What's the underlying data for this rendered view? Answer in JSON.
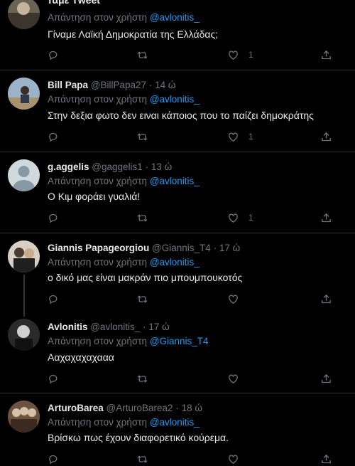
{
  "header": {
    "title": "Ταμε Τweet"
  },
  "tweets": [
    {
      "name": "",
      "handle": "",
      "time": "",
      "reply_prefix": "Απάντηση στον χρήστη",
      "reply_to": "@avlonitis_",
      "text": "Γίναμε Λαϊκή Δημοκρατία της Ελλάδας;",
      "likes": "1"
    },
    {
      "name": "Bill Papa",
      "handle": "@BillPapa27",
      "time": "14 ώ",
      "reply_prefix": "Απάντηση στον χρήστη",
      "reply_to": "@avlonitis_",
      "text": "Στην δεξια φωτο δεν ειναι κάποιος που το παίζει δημοκράτης",
      "likes": "1"
    },
    {
      "name": "g.aggelis",
      "handle": "@gaggelis1",
      "time": "13 ώ",
      "reply_prefix": "Απάντηση στον χρήστη",
      "reply_to": "@avlonitis_",
      "text": "Ο Κιμ φοράει γυαλιά!",
      "likes": "1"
    },
    {
      "name": "Giannis Papageorgiou",
      "handle": "@Giannis_T4",
      "time": "17 ώ",
      "reply_prefix": "Απάντηση στον χρήστη",
      "reply_to": "@avlonitis_",
      "text": "ο δικό μας είναι μακράν πιο μπουμπουκοτός",
      "likes": ""
    },
    {
      "name": "Avlonitis",
      "handle": "@avlonitis_",
      "time": "17 ώ",
      "reply_prefix": "Απάντηση στον χρήστη",
      "reply_to": "@Giannis_T4",
      "text": "Ααχαχαχαχααα",
      "likes": ""
    },
    {
      "name": "ArturoBarea",
      "handle": "@ArturoBarea2",
      "time": "18 ώ",
      "reply_prefix": "Απάντηση στον χρήστη",
      "reply_to": "@avlonitis_",
      "text": "Βρίσκω πως έχουν διαφορετικό κούρεμα.",
      "likes": ""
    }
  ],
  "icons": {
    "reply": "reply-icon",
    "retweet": "retweet-icon",
    "like": "heart-icon",
    "share": "share-icon"
  },
  "colors": {
    "background": "#000000",
    "link": "#1d9bf0",
    "muted": "#71767b",
    "text": "#e7e9ea"
  }
}
